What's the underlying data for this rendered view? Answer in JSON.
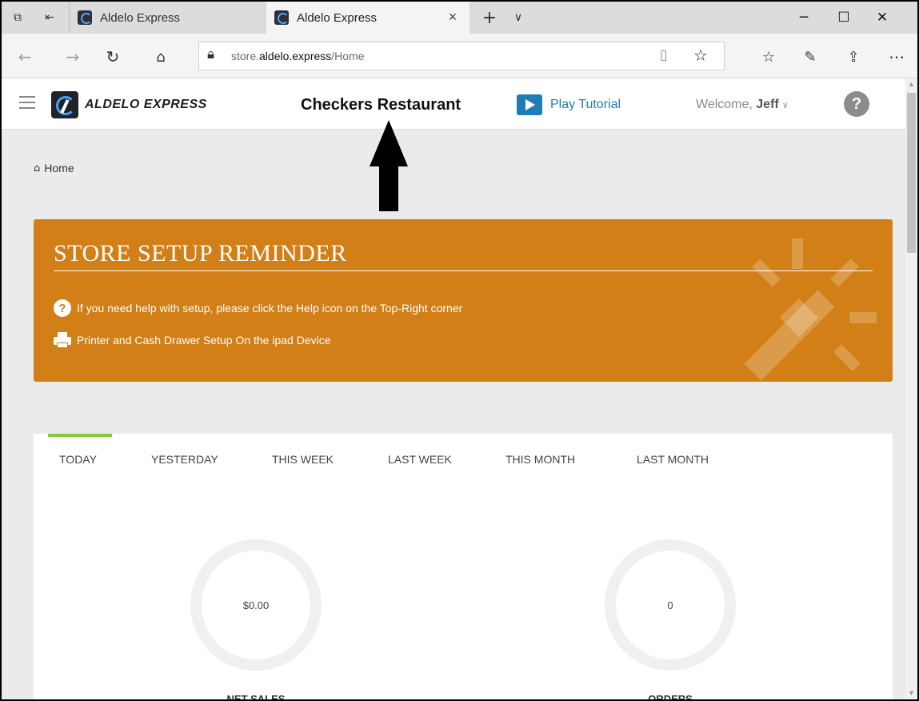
{
  "browser": {
    "tabs": [
      {
        "label": "Aldelo Express"
      },
      {
        "label": "Aldelo Express"
      }
    ],
    "close_glyph": "×",
    "new_tab_glyph": "+",
    "tab_menu_glyph": "∨",
    "window": {
      "minimize": "─",
      "maximize": "☐",
      "close": "✕"
    },
    "url_prefix": "store.",
    "url_domain": "aldelo.express",
    "url_path": "/Home"
  },
  "header": {
    "logo_text": "ALDELO EXPRESS",
    "store_name": "Checkers Restaurant",
    "tutorial_label": "Play Tutorial",
    "welcome_prefix": "Welcome, ",
    "user": "Jeff",
    "help": "?"
  },
  "breadcrumb": {
    "label": "Home"
  },
  "reminder": {
    "title": "STORE SETUP REMINDER",
    "help_line": "If you need help with setup, please click the Help icon on the Top-Right corner",
    "printer_line": "Printer and Cash Drawer Setup On the ipad Device",
    "help_badge": "?"
  },
  "stats": {
    "tabs": [
      "TODAY",
      "YESTERDAY",
      "THIS WEEK",
      "LAST WEEK",
      "THIS MONTH",
      "LAST MONTH"
    ],
    "active_tab": "TODAY",
    "net_sales_value": "$0.00",
    "net_sales_label": "NET SALES",
    "orders_value": "0",
    "orders_label": "ORDERS"
  },
  "colors": {
    "accent_orange": "#d17f16",
    "tab_indicator_green": "#8dc63f",
    "tutorial_blue": "#1e7db7"
  }
}
